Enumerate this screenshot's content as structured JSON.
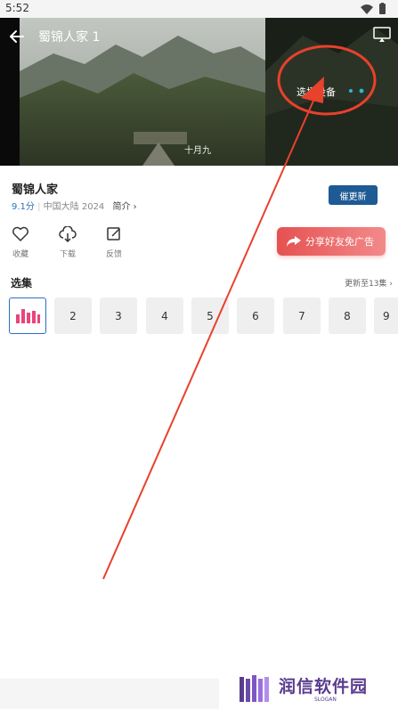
{
  "status_bar": {
    "time": "5:52"
  },
  "player": {
    "title": "蜀锦人家 1",
    "select_device": "选择设备",
    "subtitle": "十月九"
  },
  "show": {
    "title": "蜀锦人家",
    "score": "9.1分",
    "region": "中国大陆",
    "year": "2024",
    "intro_link": "简介 ›",
    "urge_button": "催更新"
  },
  "actions": [
    {
      "label": "收藏",
      "icon": "heart-icon"
    },
    {
      "label": "下载",
      "icon": "cloud-download-icon"
    },
    {
      "label": "反馈",
      "icon": "edit-icon"
    }
  ],
  "share_button": "分享好友免广告",
  "episodes": {
    "heading": "选集",
    "more": "更新至13集 ›",
    "items": [
      "",
      "2",
      "3",
      "4",
      "5",
      "6",
      "7",
      "8",
      "9"
    ]
  },
  "brand": {
    "name": "润信软件园",
    "slogan": "SLOGAN"
  },
  "colors": {
    "accent_blue": "#1e5a93",
    "share_red": "#e65151",
    "annotation_red": "#e8412c",
    "brand_purple": "#5a3c8f"
  }
}
